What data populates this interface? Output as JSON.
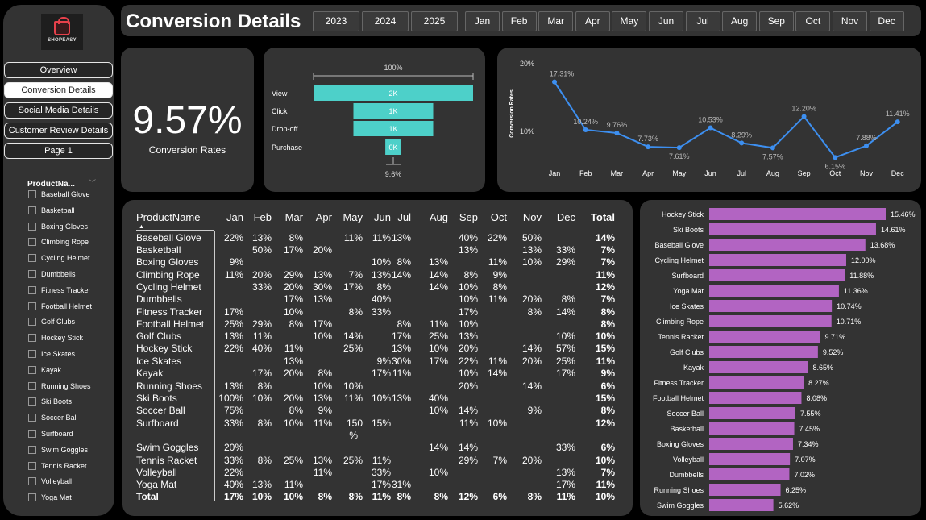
{
  "sidebar": {
    "logo_text": "SHOPEASY",
    "nav": [
      "Overview",
      "Conversion Details",
      "Social Media Details",
      "Customer Review Details",
      "Page 1"
    ],
    "active_nav": "Conversion Details",
    "slicer_title": "ProductNa...",
    "slicer_items": [
      "Baseball Glove",
      "Basketball",
      "Boxing Gloves",
      "Climbing Rope",
      "Cycling Helmet",
      "Dumbbells",
      "Fitness Tracker",
      "Football Helmet",
      "Golf Clubs",
      "Hockey Stick",
      "Ice Skates",
      "Kayak",
      "Running Shoes",
      "Ski Boots",
      "Soccer Ball",
      "Surfboard",
      "Swim Goggles",
      "Tennis Racket",
      "Volleyball",
      "Yoga Mat"
    ]
  },
  "header": {
    "title": "Conversion Details",
    "years": [
      "2023",
      "2024",
      "2025"
    ],
    "months": [
      "Jan",
      "Feb",
      "Mar",
      "Apr",
      "May",
      "Jun",
      "Jul",
      "Aug",
      "Sep",
      "Oct",
      "Nov",
      "Dec"
    ]
  },
  "kpi": {
    "value": "9.57%",
    "label": "Conversion Rates"
  },
  "colors": {
    "panel": "#333333",
    "funnel": "#4dd0c9",
    "line": "#3d8ff0",
    "bar": "#b264c2"
  },
  "chart_data": [
    {
      "type": "bar",
      "subtype": "funnel",
      "categories": [
        "View",
        "Click",
        "Drop-off",
        "Purchase"
      ],
      "values": [
        2000,
        1000,
        1000,
        200
      ],
      "data_labels": [
        "2K",
        "1K",
        "1K",
        "0K"
      ],
      "top_label": "100%",
      "bottom_label": "9.6%"
    },
    {
      "type": "line",
      "x": [
        "Jan",
        "Feb",
        "Mar",
        "Apr",
        "May",
        "Jun",
        "Jul",
        "Aug",
        "Sep",
        "Oct",
        "Nov",
        "Dec"
      ],
      "values": [
        17.31,
        10.24,
        9.76,
        7.73,
        7.61,
        10.53,
        8.29,
        7.57,
        12.2,
        6.15,
        7.88,
        11.41
      ],
      "data_labels": [
        "17.31%",
        "10.24%",
        "9.76%",
        "7.73%",
        "7.61%",
        "10.53%",
        "8.29%",
        "7.57%",
        "12.20%",
        "6.15%",
        "7.88%",
        "11.41%"
      ],
      "ylabel": "Conversion Rates",
      "yticks": [
        "10%",
        "20%"
      ],
      "ylim": [
        5,
        20
      ]
    },
    {
      "type": "table",
      "columns": [
        "ProductName",
        "Jan",
        "Feb",
        "Mar",
        "Apr",
        "May",
        "Jun",
        "Jul",
        "Aug",
        "Sep",
        "Oct",
        "Nov",
        "Dec",
        "Total"
      ],
      "rows": [
        [
          "Baseball Glove",
          "22%",
          "13%",
          "8%",
          "",
          "11%",
          "11%",
          "13%",
          "",
          "40%",
          "22%",
          "50%",
          "",
          "14%"
        ],
        [
          "Basketball",
          "",
          "50%",
          "17%",
          "20%",
          "",
          "",
          "",
          "",
          "13%",
          "",
          "13%",
          "33%",
          "7%"
        ],
        [
          "Boxing Gloves",
          "9%",
          "",
          "",
          "",
          "",
          "10%",
          "8%",
          "13%",
          "",
          "11%",
          "10%",
          "29%",
          "7%"
        ],
        [
          "Climbing Rope",
          "11%",
          "20%",
          "29%",
          "13%",
          "7%",
          "13%",
          "14%",
          "14%",
          "8%",
          "9%",
          "",
          "",
          "11%"
        ],
        [
          "Cycling Helmet",
          "",
          "33%",
          "20%",
          "30%",
          "17%",
          "8%",
          "",
          "14%",
          "10%",
          "8%",
          "",
          "",
          "12%"
        ],
        [
          "Dumbbells",
          "",
          "",
          "17%",
          "13%",
          "",
          "40%",
          "",
          "",
          "10%",
          "11%",
          "20%",
          "8%",
          "7%"
        ],
        [
          "Fitness Tracker",
          "17%",
          "",
          "10%",
          "",
          "8%",
          "33%",
          "",
          "",
          "17%",
          "",
          "8%",
          "14%",
          "8%"
        ],
        [
          "Football Helmet",
          "25%",
          "29%",
          "8%",
          "17%",
          "",
          "",
          "8%",
          "11%",
          "10%",
          "",
          "",
          "",
          "8%"
        ],
        [
          "Golf Clubs",
          "13%",
          "11%",
          "",
          "10%",
          "14%",
          "",
          "17%",
          "25%",
          "13%",
          "",
          "",
          "10%",
          "10%"
        ],
        [
          "Hockey Stick",
          "22%",
          "40%",
          "11%",
          "",
          "25%",
          "",
          "13%",
          "10%",
          "20%",
          "",
          "14%",
          "57%",
          "15%"
        ],
        [
          "Ice Skates",
          "",
          "",
          "13%",
          "",
          "",
          "9%",
          "30%",
          "17%",
          "22%",
          "11%",
          "20%",
          "25%",
          "11%"
        ],
        [
          "Kayak",
          "",
          "17%",
          "20%",
          "8%",
          "",
          "17%",
          "11%",
          "",
          "10%",
          "14%",
          "",
          "17%",
          "9%"
        ],
        [
          "Running Shoes",
          "13%",
          "8%",
          "",
          "10%",
          "10%",
          "",
          "",
          "",
          "20%",
          "",
          "14%",
          "",
          "6%"
        ],
        [
          "Ski Boots",
          "100%",
          "10%",
          "20%",
          "13%",
          "11%",
          "10%",
          "13%",
          "40%",
          "",
          "",
          "",
          "",
          "15%"
        ],
        [
          "Soccer Ball",
          "75%",
          "",
          "8%",
          "9%",
          "",
          "",
          "",
          "10%",
          "14%",
          "",
          "9%",
          "",
          "8%"
        ],
        [
          "Surfboard",
          "33%",
          "8%",
          "10%",
          "11%",
          "150%",
          "15%",
          "",
          "",
          "11%",
          "10%",
          "",
          "",
          "12%"
        ],
        [
          "Swim Goggles",
          "20%",
          "",
          "",
          "",
          "",
          "",
          "",
          "14%",
          "14%",
          "",
          "",
          "33%",
          "6%"
        ],
        [
          "Tennis Racket",
          "33%",
          "8%",
          "25%",
          "13%",
          "25%",
          "11%",
          "",
          "",
          "29%",
          "7%",
          "20%",
          "",
          "10%"
        ],
        [
          "Volleyball",
          "22%",
          "",
          "",
          "11%",
          "",
          "33%",
          "",
          "10%",
          "",
          "",
          "",
          "13%",
          "7%"
        ],
        [
          "Yoga Mat",
          "40%",
          "13%",
          "11%",
          "",
          "",
          "17%",
          "31%",
          "",
          "",
          "",
          "",
          "17%",
          "11%"
        ]
      ],
      "total_row": [
        "Total",
        "17%",
        "10%",
        "10%",
        "8%",
        "8%",
        "11%",
        "8%",
        "8%",
        "12%",
        "6%",
        "8%",
        "11%",
        "10%"
      ],
      "sort_column": "ProductName"
    },
    {
      "type": "bar",
      "orientation": "horizontal",
      "categories": [
        "Hockey Stick",
        "Ski Boots",
        "Baseball Glove",
        "Cycling Helmet",
        "Surfboard",
        "Yoga Mat",
        "Ice Skates",
        "Climbing Rope",
        "Tennis Racket",
        "Golf Clubs",
        "Kayak",
        "Fitness Tracker",
        "Football Helmet",
        "Soccer Ball",
        "Basketball",
        "Boxing Gloves",
        "Volleyball",
        "Dumbbells",
        "Running Shoes",
        "Swim Goggles"
      ],
      "values": [
        15.46,
        14.61,
        13.68,
        12.0,
        11.88,
        11.36,
        10.74,
        10.71,
        9.71,
        9.52,
        8.65,
        8.27,
        8.08,
        7.55,
        7.45,
        7.34,
        7.07,
        7.02,
        6.25,
        5.62
      ],
      "data_labels": [
        "15.46%",
        "14.61%",
        "13.68%",
        "12.00%",
        "11.88%",
        "11.36%",
        "10.74%",
        "10.71%",
        "9.71%",
        "9.52%",
        "8.65%",
        "8.27%",
        "8.08%",
        "7.55%",
        "7.45%",
        "7.34%",
        "7.07%",
        "7.02%",
        "6.25%",
        "5.62%"
      ]
    }
  ]
}
